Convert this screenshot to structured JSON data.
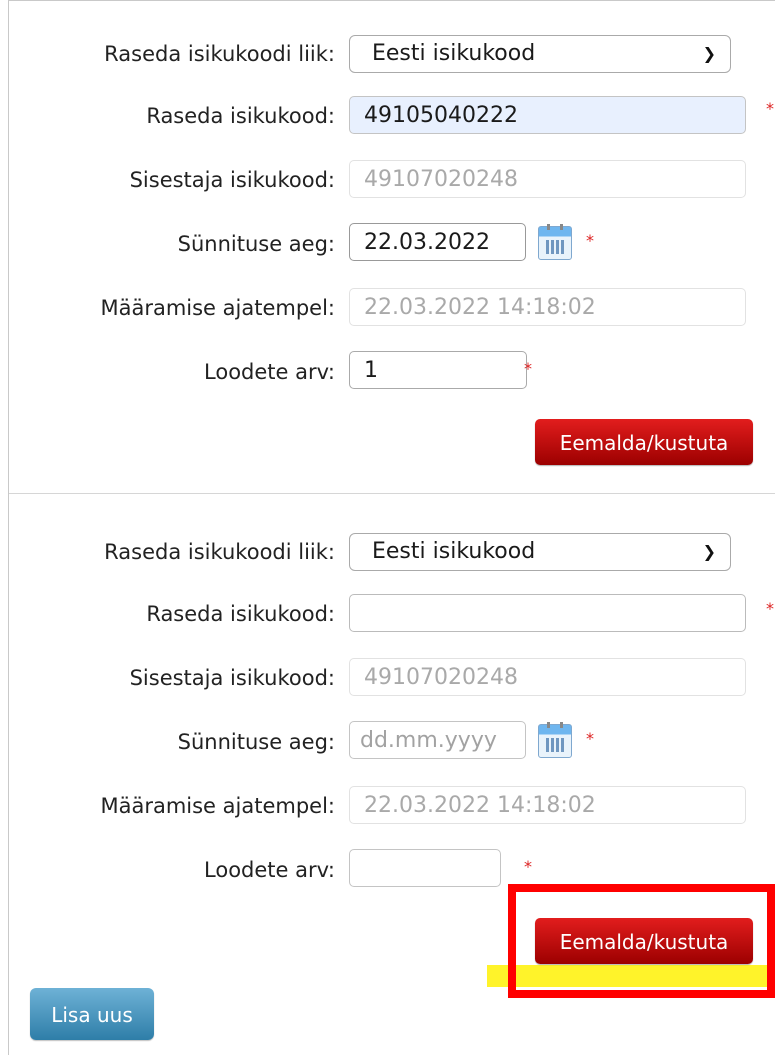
{
  "forms": [
    {
      "type_label": "Raseda isikukoodi liik:",
      "type_value": "Eesti isikukood",
      "pid_label": "Raseda isikukood:",
      "pid_value": "49105040222",
      "enterer_label": "Sisestaja isikukood:",
      "enterer_value": "49107020248",
      "birth_label": "Sünnituse aeg:",
      "birth_value": "22.03.2022",
      "birth_placeholder": "dd.mm.yyyy",
      "timestamp_label": "Määramise ajatempel:",
      "timestamp_value": "22.03.2022 14:18:02",
      "fetus_label": "Loodete arv:",
      "fetus_value": "1",
      "remove_label": "Eemalda/kustuta"
    },
    {
      "type_label": "Raseda isikukoodi liik:",
      "type_value": "Eesti isikukood",
      "pid_label": "Raseda isikukood:",
      "pid_value": "",
      "enterer_label": "Sisestaja isikukood:",
      "enterer_value": "49107020248",
      "birth_label": "Sünnituse aeg:",
      "birth_value": "",
      "birth_placeholder": "dd.mm.yyyy",
      "timestamp_label": "Määramise ajatempel:",
      "timestamp_value": "22.03.2022 14:18:02",
      "fetus_label": "Loodete arv:",
      "fetus_value": "",
      "remove_label": "Eemalda/kustuta"
    }
  ],
  "required_mark": "*",
  "add_new_label": "Lisa uus",
  "colors": {
    "remove_button": "#c40a0a",
    "add_button": "#3f8fba",
    "required": "#dd2222",
    "annotation_box": "#ff0000",
    "annotation_highlight": "#fff32a"
  },
  "icons": {
    "calendar": "calendar-icon",
    "select_arrow": "chevron-down-icon"
  }
}
